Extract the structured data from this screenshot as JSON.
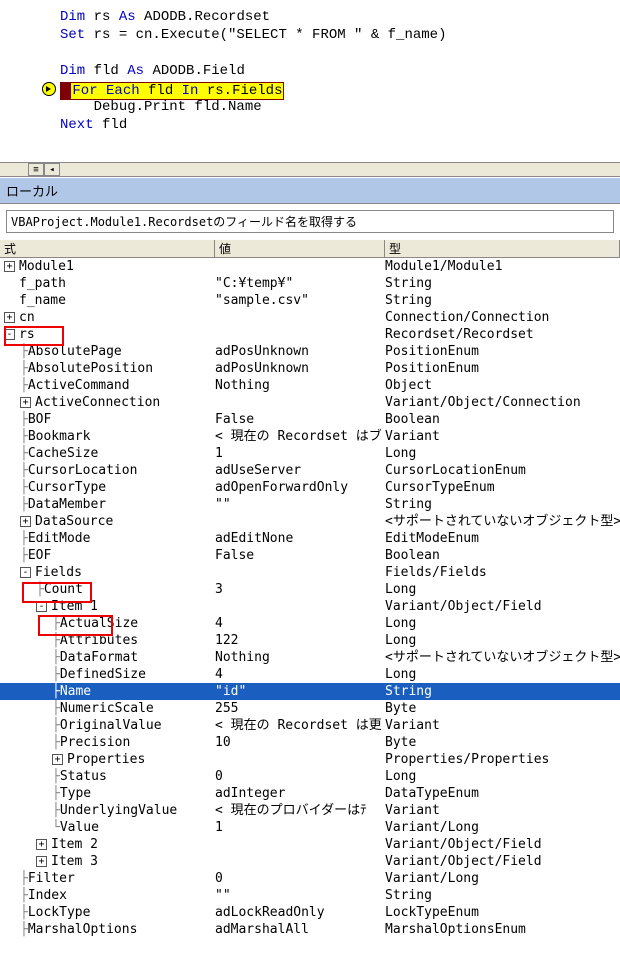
{
  "code": {
    "l1a": "Dim ",
    "l1b": "rs ",
    "l1c": "As ",
    "l1d": "ADODB.Recordset",
    "l2a": "Set ",
    "l2b": "rs = cn.Execute(\"SELECT * FROM \" & f_name)",
    "l3a": "Dim ",
    "l3b": "fld ",
    "l3c": "As ",
    "l3d": "ADODB.Field",
    "l4a": "For Each ",
    "l4b": "fld ",
    "l4c": "In ",
    "l4d": "rs.Fields",
    "l5a": "Debug.Print fld.Name",
    "l6a": "Next ",
    "l6b": "fld"
  },
  "panel": {
    "title": "ローカル",
    "subtitle": "VBAProject.Module1.Recordsetのフィールド名を取得する",
    "hdr_expr": "式",
    "hdr_val": "値",
    "hdr_type": "型"
  },
  "r": {
    "mod": {
      "e": "Module1",
      "t": "Module1/Module1"
    },
    "fpath": {
      "e": "f_path",
      "v": "\"C:¥temp¥\"",
      "t": "String"
    },
    "fname": {
      "e": "f_name",
      "v": "\"sample.csv\"",
      "t": "String"
    },
    "cn": {
      "e": "cn",
      "t": "Connection/Connection"
    },
    "rs": {
      "e": "rs",
      "t": "Recordset/Recordset"
    },
    "abspage": {
      "e": "AbsolutePage",
      "v": "adPosUnknown",
      "t": "PositionEnum"
    },
    "abspos": {
      "e": "AbsolutePosition",
      "v": "adPosUnknown",
      "t": "PositionEnum"
    },
    "actcmd": {
      "e": "ActiveCommand",
      "v": "Nothing",
      "t": "Object"
    },
    "actcon": {
      "e": "ActiveConnection",
      "t": "Variant/Object/Connection"
    },
    "bof": {
      "e": "BOF",
      "v": "False",
      "t": "Boolean"
    },
    "bookmark": {
      "e": "Bookmark",
      "v": "< 現在の Recordset はブ",
      "t": "Variant"
    },
    "cache": {
      "e": "CacheSize",
      "v": "1",
      "t": "Long"
    },
    "curloc": {
      "e": "CursorLocation",
      "v": "adUseServer",
      "t": "CursorLocationEnum"
    },
    "curtyp": {
      "e": "CursorType",
      "v": "adOpenForwardOnly",
      "t": "CursorTypeEnum"
    },
    "datamem": {
      "e": "DataMember",
      "v": "\"\"",
      "t": "String"
    },
    "datasrc": {
      "e": "DataSource",
      "t": "<サポートされていないオブジェクト型>"
    },
    "editmode": {
      "e": "EditMode",
      "v": "adEditNone",
      "t": "EditModeEnum"
    },
    "eof": {
      "e": "EOF",
      "v": "False",
      "t": "Boolean"
    },
    "fields": {
      "e": "Fields",
      "t": "Fields/Fields"
    },
    "count": {
      "e": "Count",
      "v": "3",
      "t": "Long"
    },
    "item1": {
      "e": "Item 1",
      "t": "Variant/Object/Field"
    },
    "actual": {
      "e": "ActualSize",
      "v": "4",
      "t": "Long"
    },
    "attrs": {
      "e": "Attributes",
      "v": "122",
      "t": "Long"
    },
    "datafmt": {
      "e": "DataFormat",
      "v": "Nothing",
      "t": "<サポートされていないオブジェクト型>"
    },
    "defsize": {
      "e": "DefinedSize",
      "v": "4",
      "t": "Long"
    },
    "name": {
      "e": "Name",
      "v": "\"id\"",
      "t": "String"
    },
    "numscale": {
      "e": "NumericScale",
      "v": "255",
      "t": "Byte"
    },
    "origval": {
      "e": "OriginalValue",
      "v": "< 現在の Recordset は更",
      "t": "Variant"
    },
    "prec": {
      "e": "Precision",
      "v": "10",
      "t": "Byte"
    },
    "props": {
      "e": "Properties",
      "t": "Properties/Properties"
    },
    "status": {
      "e": "Status",
      "v": "0",
      "t": "Long"
    },
    "type": {
      "e": "Type",
      "v": "adInteger",
      "t": "DataTypeEnum"
    },
    "under": {
      "e": "UnderlyingValue",
      "v": "< 現在のプロバイダーはﾃ",
      "t": "Variant"
    },
    "value": {
      "e": "Value",
      "v": "1",
      "t": "Variant/Long"
    },
    "item2": {
      "e": "Item 2",
      "t": "Variant/Object/Field"
    },
    "item3": {
      "e": "Item 3",
      "t": "Variant/Object/Field"
    },
    "filter": {
      "e": "Filter",
      "v": "0",
      "t": "Variant/Long"
    },
    "index": {
      "e": "Index",
      "v": "\"\"",
      "t": "String"
    },
    "locktype": {
      "e": "LockType",
      "v": "adLockReadOnly",
      "t": "LockTypeEnum"
    },
    "marshal": {
      "e": "MarshalOptions",
      "v": "adMarshalAll",
      "t": "MarshalOptionsEnum"
    }
  }
}
